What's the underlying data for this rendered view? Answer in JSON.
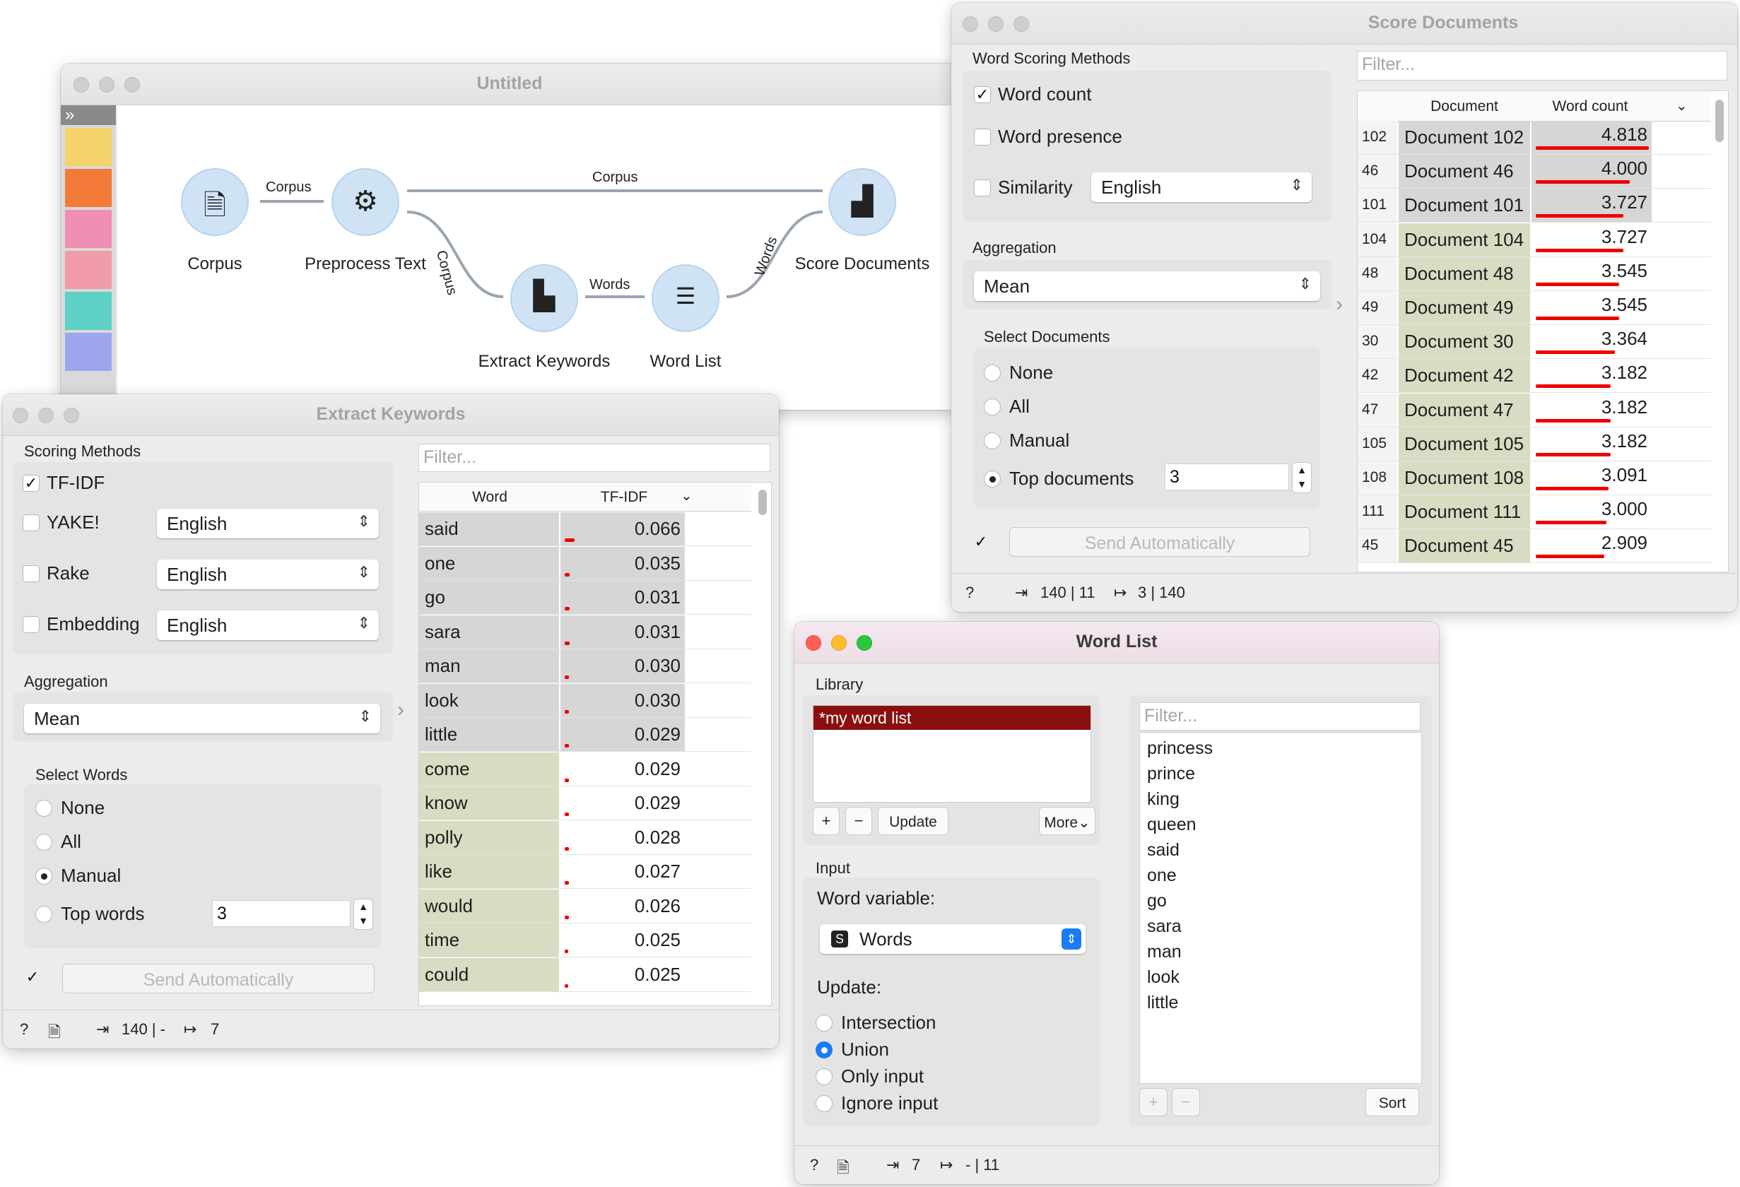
{
  "canvas": {
    "title": "Untitled",
    "nodes": [
      {
        "label": "Corpus"
      },
      {
        "label": "Preprocess Text"
      },
      {
        "label": "Extract Keywords"
      },
      {
        "label": "Word List"
      },
      {
        "label": "Score Documents"
      }
    ],
    "links": {
      "corpus_to_preprocess": "Corpus",
      "preprocess_to_score": "Corpus",
      "preprocess_to_extract": "Corpus",
      "extract_to_wordlist": "Words",
      "wordlist_to_score": "Words"
    },
    "toolbox_colors": [
      "#808080",
      "#f47a3a",
      "#f08fb4",
      "#f29ba9",
      "#5fd0c6",
      "#9da6ed"
    ]
  },
  "extract": {
    "title": "Extract Keywords",
    "scoring_title": "Scoring Methods",
    "methods": [
      {
        "label": "TF-IDF",
        "checked": true
      },
      {
        "label": "YAKE!",
        "checked": false,
        "lang": "English"
      },
      {
        "label": "Rake",
        "checked": false,
        "lang": "English"
      },
      {
        "label": "Embedding",
        "checked": false,
        "lang": "English"
      }
    ],
    "aggregation_title": "Aggregation",
    "aggregation_value": "Mean",
    "select_title": "Select Words",
    "select_options": [
      "None",
      "All",
      "Manual",
      "Top words"
    ],
    "selected_option": "Manual",
    "top_value": "3",
    "send_label": "Send Automatically",
    "filter_placeholder": "Filter...",
    "columns": [
      "Word",
      "TF-IDF"
    ],
    "rows": [
      {
        "word": "said",
        "score": "0.066",
        "bar": 0.066
      },
      {
        "word": "one",
        "score": "0.035",
        "bar": 0.035
      },
      {
        "word": "go",
        "score": "0.031",
        "bar": 0.031
      },
      {
        "word": "sara",
        "score": "0.031",
        "bar": 0.031
      },
      {
        "word": "man",
        "score": "0.030",
        "bar": 0.03
      },
      {
        "word": "look",
        "score": "0.030",
        "bar": 0.03
      },
      {
        "word": "little",
        "score": "0.029",
        "bar": 0.029
      },
      {
        "word": "come",
        "score": "0.029",
        "bar": 0.029
      },
      {
        "word": "know",
        "score": "0.029",
        "bar": 0.029
      },
      {
        "word": "polly",
        "score": "0.028",
        "bar": 0.028
      },
      {
        "word": "like",
        "score": "0.027",
        "bar": 0.027
      },
      {
        "word": "would",
        "score": "0.026",
        "bar": 0.026
      },
      {
        "word": "time",
        "score": "0.025",
        "bar": 0.025
      },
      {
        "word": "could",
        "score": "0.025",
        "bar": 0.025
      }
    ],
    "status_in": "140 | -",
    "status_out": "7"
  },
  "score": {
    "title": "Score Documents",
    "methods_title": "Word Scoring Methods",
    "methods": [
      {
        "label": "Word count",
        "checked": true
      },
      {
        "label": "Word presence",
        "checked": false
      },
      {
        "label": "Similarity",
        "checked": false,
        "lang": "English"
      }
    ],
    "aggregation_title": "Aggregation",
    "aggregation_value": "Mean",
    "select_title": "Select Documents",
    "select_options": [
      "None",
      "All",
      "Manual",
      "Top documents"
    ],
    "selected_option": "Top documents",
    "top_value": "3",
    "send_label": "Send Automatically",
    "filter_placeholder": "Filter...",
    "columns": [
      "Document",
      "Word count"
    ],
    "rows": [
      {
        "idx": "102",
        "doc": "Document 102",
        "value": "4.818",
        "bar": 4.818
      },
      {
        "idx": "46",
        "doc": "Document 46",
        "value": "4.000",
        "bar": 4.0
      },
      {
        "idx": "101",
        "doc": "Document 101",
        "value": "3.727",
        "bar": 3.727
      },
      {
        "idx": "104",
        "doc": "Document 104",
        "value": "3.727",
        "bar": 3.727
      },
      {
        "idx": "48",
        "doc": "Document 48",
        "value": "3.545",
        "bar": 3.545
      },
      {
        "idx": "49",
        "doc": "Document 49",
        "value": "3.545",
        "bar": 3.545
      },
      {
        "idx": "30",
        "doc": "Document 30",
        "value": "3.364",
        "bar": 3.364
      },
      {
        "idx": "42",
        "doc": "Document 42",
        "value": "3.182",
        "bar": 3.182
      },
      {
        "idx": "47",
        "doc": "Document 47",
        "value": "3.182",
        "bar": 3.182
      },
      {
        "idx": "105",
        "doc": "Document 105",
        "value": "3.182",
        "bar": 3.182
      },
      {
        "idx": "108",
        "doc": "Document 108",
        "value": "3.091",
        "bar": 3.091
      },
      {
        "idx": "111",
        "doc": "Document 111",
        "value": "3.000",
        "bar": 3.0
      },
      {
        "idx": "45",
        "doc": "Document 45",
        "value": "2.909",
        "bar": 2.909
      }
    ],
    "status_in": "140 | 11",
    "status_out": "3 | 140"
  },
  "wordlist": {
    "title": "Word List",
    "library_title": "Library",
    "library_item": "*my word list",
    "update_label": "Update",
    "more_label": "More",
    "input_title": "Input",
    "word_variable_label": "Word variable:",
    "word_variable_value": "Words",
    "update_title": "Update:",
    "update_options": [
      "Intersection",
      "Union",
      "Only input",
      "Ignore input"
    ],
    "selected_update": "Union",
    "filter_placeholder": "Filter...",
    "words": [
      "princess",
      "prince",
      "king",
      "queen",
      "said",
      "one",
      "go",
      "sara",
      "man",
      "look",
      "little"
    ],
    "sort_label": "Sort",
    "status_in": "7",
    "status_out": "- | 11"
  }
}
